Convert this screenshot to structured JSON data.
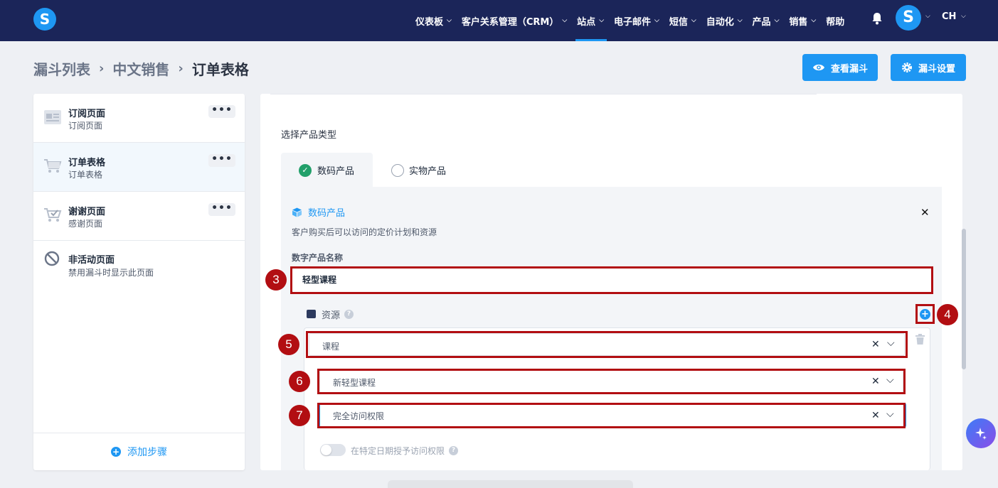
{
  "app": {
    "logo_letter": "S",
    "avatar_letter": "S",
    "language": "CH"
  },
  "nav": {
    "items": [
      {
        "label": "仪表板",
        "has_menu": true
      },
      {
        "label": "客户关系管理（CRM）",
        "has_menu": true
      },
      {
        "label": "站点",
        "has_menu": true,
        "active": true
      },
      {
        "label": "电子邮件",
        "has_menu": true
      },
      {
        "label": "短信",
        "has_menu": true
      },
      {
        "label": "自动化",
        "has_menu": true
      },
      {
        "label": "产品",
        "has_menu": true
      },
      {
        "label": "销售",
        "has_menu": true
      },
      {
        "label": "帮助",
        "has_menu": false
      }
    ]
  },
  "breadcrumb": {
    "items": [
      "漏斗列表",
      "中文销售",
      "订单表格"
    ]
  },
  "actions": {
    "view_funnel": "查看漏斗",
    "funnel_settings": "漏斗设置"
  },
  "sidebar": {
    "steps": [
      {
        "title": "订阅页面",
        "subtitle": "订阅页面",
        "icon": "form-page-icon",
        "more": "•••"
      },
      {
        "title": "订单表格",
        "subtitle": "订单表格",
        "icon": "cart-icon",
        "more": "•••",
        "active": true
      },
      {
        "title": "谢谢页面",
        "subtitle": "感谢页面",
        "icon": "cart-check-icon",
        "more": "•••"
      },
      {
        "title": "非活动页面",
        "subtitle": "禁用漏斗时显示此页面",
        "icon": "disabled-icon"
      }
    ],
    "add_step": "添加步骤"
  },
  "product": {
    "type_label": "选择产品类型",
    "tabs": [
      {
        "label": "数码产品",
        "selected": true
      },
      {
        "label": "实物产品",
        "selected": false
      }
    ],
    "panel_title": "数码产品",
    "panel_desc": "客户购买后可以访问的定价计划和资源",
    "name_label": "数字产品名称",
    "name_value": "轻型课程",
    "resources_label": "资源",
    "resource_type": "课程",
    "course": "新轻型课程",
    "access": "完全访问权限",
    "toggle_label": "在特定日期授予访问权限"
  },
  "annotations": [
    "3",
    "4",
    "5",
    "6",
    "7"
  ],
  "colors": {
    "nav_bg": "#1b2559",
    "primary": "#1e97f3",
    "annotation": "#b20e12",
    "success": "#22a06b"
  }
}
